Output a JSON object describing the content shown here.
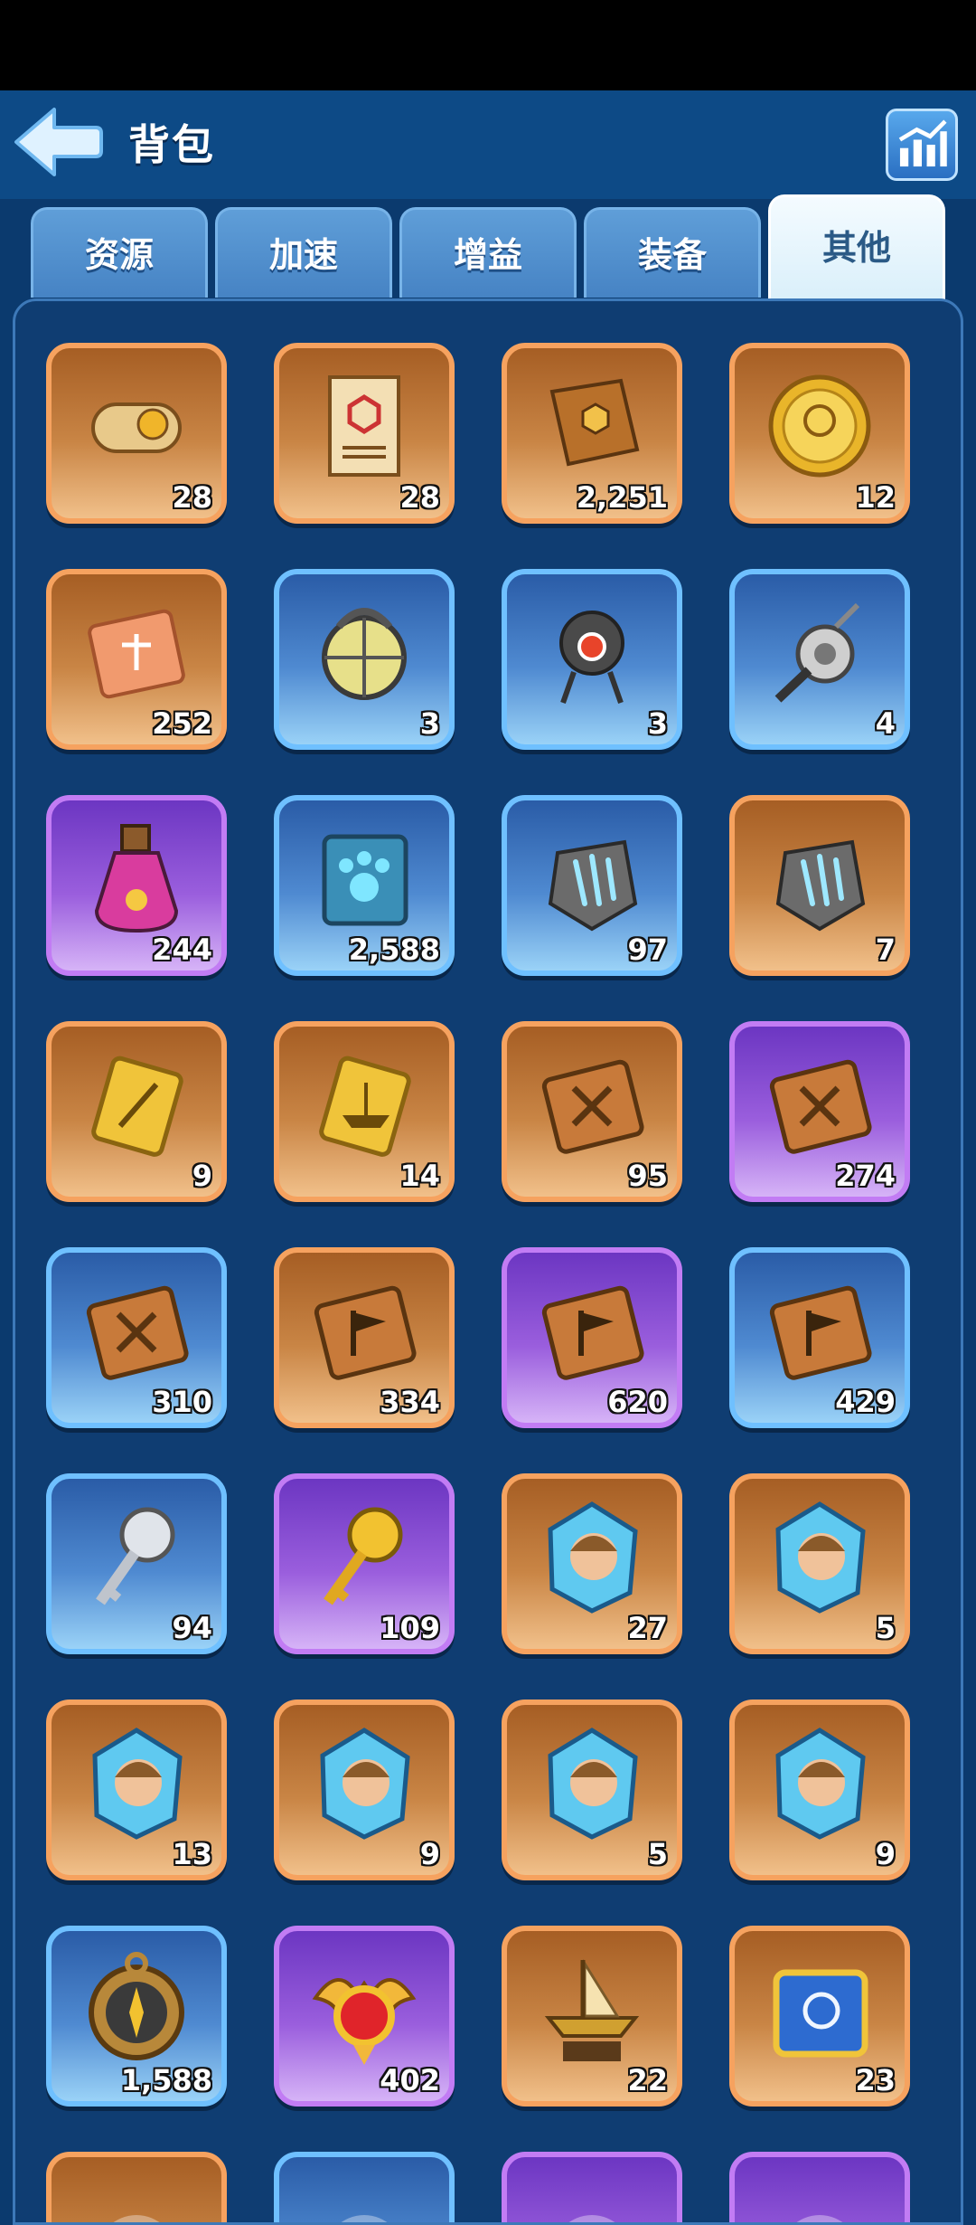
{
  "header": {
    "title": "背包",
    "back_icon": "back-arrow-icon",
    "stats_icon": "bar-chart-icon"
  },
  "tabs": [
    {
      "label": "资源",
      "active": false
    },
    {
      "label": "加速",
      "active": false
    },
    {
      "label": "增益",
      "active": false
    },
    {
      "label": "装备",
      "active": false
    },
    {
      "label": "其他",
      "active": true
    }
  ],
  "colors": {
    "orange": "#f6a25f",
    "blue": "#6fc0ff",
    "purple": "#c27cf4",
    "background": "#0b3a6e"
  },
  "items": [
    {
      "icon": "scroll-icon",
      "rarity": "orange",
      "count": "28"
    },
    {
      "icon": "parchment-icon",
      "rarity": "orange",
      "count": "28"
    },
    {
      "icon": "book-icon",
      "rarity": "orange",
      "count": "2,251"
    },
    {
      "icon": "gold-coin-icon",
      "rarity": "orange",
      "count": "12"
    },
    {
      "icon": "ticket-icon",
      "rarity": "orange",
      "count": "252"
    },
    {
      "icon": "lantern-icon",
      "rarity": "blue",
      "count": "3"
    },
    {
      "icon": "robot-drone-icon",
      "rarity": "blue",
      "count": "3"
    },
    {
      "icon": "fishing-reel-icon",
      "rarity": "blue",
      "count": "4"
    },
    {
      "icon": "potion-icon",
      "rarity": "purple",
      "count": "244"
    },
    {
      "icon": "paw-book-icon",
      "rarity": "blue",
      "count": "2,588"
    },
    {
      "icon": "claw-stone-icon",
      "rarity": "blue",
      "count": "97"
    },
    {
      "icon": "claw-stone-icon",
      "rarity": "orange",
      "count": "7"
    },
    {
      "icon": "sword-card-icon",
      "rarity": "orange",
      "count": "9"
    },
    {
      "icon": "boat-card-icon",
      "rarity": "orange",
      "count": "14"
    },
    {
      "icon": "sword-book-icon",
      "rarity": "orange",
      "count": "95"
    },
    {
      "icon": "sword-book-icon",
      "rarity": "purple",
      "count": "274"
    },
    {
      "icon": "sword-book-icon",
      "rarity": "blue",
      "count": "310"
    },
    {
      "icon": "flag-book-icon",
      "rarity": "orange",
      "count": "334"
    },
    {
      "icon": "flag-book-icon",
      "rarity": "purple",
      "count": "620"
    },
    {
      "icon": "flag-book-icon",
      "rarity": "blue",
      "count": "429"
    },
    {
      "icon": "silver-key-icon",
      "rarity": "blue",
      "count": "94"
    },
    {
      "icon": "gold-key-icon",
      "rarity": "purple",
      "count": "109"
    },
    {
      "icon": "hero-shard-icon",
      "rarity": "orange",
      "count": "27"
    },
    {
      "icon": "hero-shard-icon",
      "rarity": "orange",
      "count": "5"
    },
    {
      "icon": "hero-shard-icon",
      "rarity": "orange",
      "count": "13"
    },
    {
      "icon": "hero-shard-icon",
      "rarity": "orange",
      "count": "9"
    },
    {
      "icon": "hero-shard-icon",
      "rarity": "orange",
      "count": "5"
    },
    {
      "icon": "hero-shard-icon",
      "rarity": "orange",
      "count": "9"
    },
    {
      "icon": "compass-icon",
      "rarity": "blue",
      "count": "1,588"
    },
    {
      "icon": "gem-medal-icon",
      "rarity": "purple",
      "count": "402"
    },
    {
      "icon": "ship-trophy-icon",
      "rarity": "orange",
      "count": "22"
    },
    {
      "icon": "blue-tome-icon",
      "rarity": "orange",
      "count": "23"
    },
    {
      "icon": "item-icon",
      "rarity": "orange",
      "count": ""
    },
    {
      "icon": "item-icon",
      "rarity": "blue",
      "count": ""
    },
    {
      "icon": "item-icon",
      "rarity": "purple",
      "count": ""
    },
    {
      "icon": "item-icon",
      "rarity": "purple",
      "count": ""
    }
  ]
}
